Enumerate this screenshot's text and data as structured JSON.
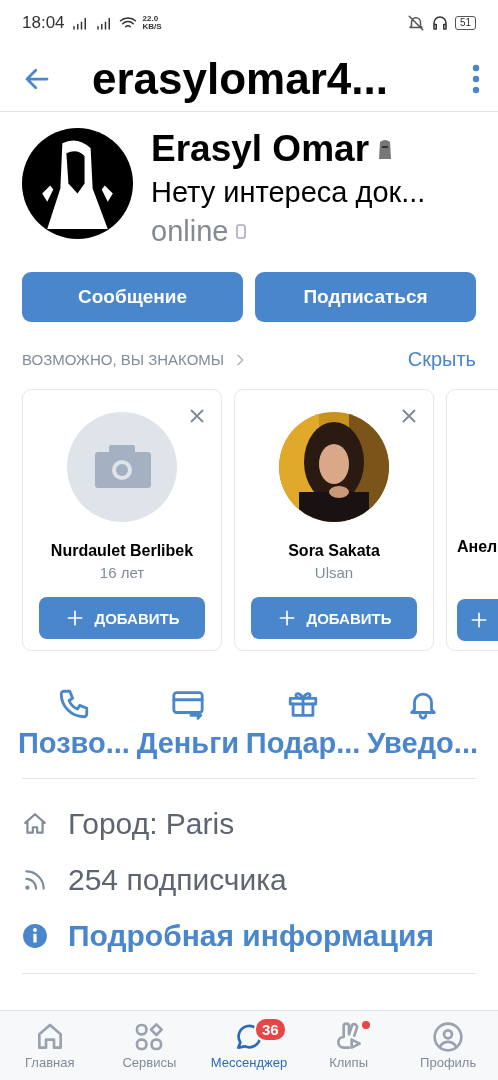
{
  "status_bar": {
    "time": "18:04",
    "speed": "22.0",
    "speed_unit": "KB/S",
    "battery": "51"
  },
  "header": {
    "title": "erasylomar4..."
  },
  "profile": {
    "name": "Erasyl Omar",
    "status": "Нету интереса док...",
    "presence": "online"
  },
  "actions": [
    {
      "label": "Сообщение"
    },
    {
      "label": "Подписаться"
    }
  ],
  "suggestions": {
    "title": "ВОЗМОЖНО, ВЫ ЗНАКОМЫ",
    "hide": "Скрыть",
    "cards": [
      {
        "kind": "placeholder",
        "name": "Nurdaulet Berlibek",
        "detail": "16 лет",
        "button": "ДОБАВИТЬ"
      },
      {
        "name": "Sora Sakata",
        "detail": "Ulsan",
        "button": "ДОБАВИТЬ"
      },
      {
        "kind": "partial",
        "name": "Анел"
      }
    ]
  },
  "quick_actions": [
    {
      "kind": "phone",
      "label": "Позво..."
    },
    {
      "kind": "money",
      "label": "Деньги"
    },
    {
      "kind": "gift",
      "label": "Подар..."
    },
    {
      "kind": "bell",
      "label": "Уведо..."
    }
  ],
  "info": [
    {
      "kind": "home",
      "text": "Город: Paris"
    },
    {
      "kind": "feed",
      "text": "254 подписчика"
    },
    {
      "kind": "more",
      "text": "Подробная информация"
    }
  ],
  "nav": [
    {
      "kind": "home",
      "label": "Главная",
      "selected": false
    },
    {
      "kind": "services",
      "label": "Сервисы",
      "selected": false
    },
    {
      "kind": "messenger",
      "label": "Мессенджер",
      "selected": true,
      "badge": "36"
    },
    {
      "kind": "clips",
      "label": "Клипы",
      "selected": false,
      "dot": true
    },
    {
      "kind": "profile",
      "label": "Профиль",
      "selected": false
    }
  ]
}
